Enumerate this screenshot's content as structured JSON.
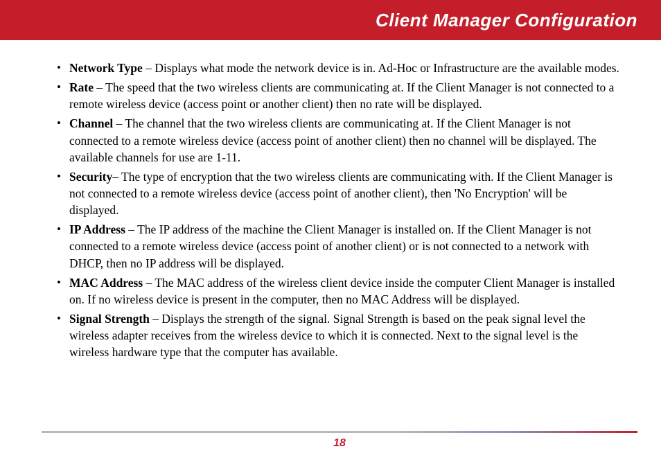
{
  "header": {
    "title": "Client Manager Configuration"
  },
  "items": [
    {
      "term": "Network Type",
      "sep": " – ",
      "desc": "Displays what mode the network device is in.  Ad-Hoc or Infrastructure are the available modes."
    },
    {
      "term": "Rate",
      "sep": " – ",
      "desc": "The speed that the two wireless clients are communicating at.  If the Client Manager is not connected to a remote wireless device (access point or another client) then no rate will be displayed."
    },
    {
      "term": "Channel",
      "sep": " – ",
      "desc": "The channel that the two wireless clients are communicating at.  If the Client Manager is not connected to a remote wireless device (access point of another client) then no channel will be displayed.  The available channels for use are 1-11."
    },
    {
      "term": "Security",
      "sep": "– ",
      "desc": "The type of encryption that the two wireless clients are communicating with.  If the Client Manager is not connected to a remote wireless device (access point of another client), then 'No Encryption' will be displayed."
    },
    {
      "term": "IP Address",
      "sep": " – ",
      "desc": "The IP address of the machine the Client Manager is installed on. If the Client Manager is not connected to a remote wireless device (access point of another client) or is not connected to a network with DHCP, then no IP address will be displayed."
    },
    {
      "term": "MAC Address",
      "sep": " – ",
      "desc": "The MAC address of the wireless client device inside the computer Client Manager is installed on. If no wireless device is present in the computer, then no MAC Address will be displayed."
    },
    {
      "term": "Signal Strength",
      "sep": " – ",
      "desc": "Displays the strength of the signal. Signal Strength is based on the peak signal level the wireless adapter receives from the wireless device to which it is connected.  Next to the signal level is the wireless hardware type that the computer has available."
    }
  ],
  "footer": {
    "page": "18"
  }
}
